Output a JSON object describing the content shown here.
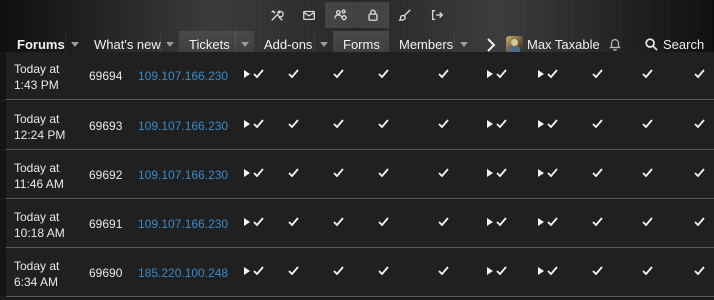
{
  "toolbar_icons": [
    "tools-icon",
    "mail-icon",
    "users-gear-icon",
    "lock-icon",
    "brush-icon",
    "logout-icon"
  ],
  "nav": {
    "tabs": [
      {
        "label": "Forums",
        "has_dropdown": true,
        "bold": true
      },
      {
        "label": "What's new",
        "has_dropdown": true
      },
      {
        "label": "Tickets",
        "has_dropdown": true,
        "highlight": true
      },
      {
        "label": "Add-ons",
        "has_dropdown": true
      },
      {
        "label": "Forms",
        "has_dropdown": false,
        "highlight": true
      },
      {
        "label": "Members",
        "has_dropdown": true
      }
    ],
    "user_name": "Max Taxable",
    "search_label": "Search"
  },
  "rows": [
    {
      "date": "Today at",
      "time": "1:43 PM",
      "id": "69694",
      "ip": "109.107.166.230",
      "marks": [
        "play-check",
        "check",
        "check",
        "check",
        "check",
        "play-check",
        "play-check",
        "check",
        "check",
        "check"
      ]
    },
    {
      "date": "Today at",
      "time": "12:24 PM",
      "id": "69693",
      "ip": "109.107.166.230",
      "marks": [
        "play-check",
        "check",
        "check",
        "check",
        "check",
        "play-check",
        "play-check",
        "check",
        "check",
        "check"
      ]
    },
    {
      "date": "Today at",
      "time": "11:46 AM",
      "id": "69692",
      "ip": "109.107.166.230",
      "marks": [
        "play-check",
        "check",
        "check",
        "check",
        "check",
        "play-check",
        "play-check",
        "check",
        "check",
        "check"
      ]
    },
    {
      "date": "Today at",
      "time": "10:18 AM",
      "id": "69691",
      "ip": "109.107.166.230",
      "marks": [
        "play-check",
        "check",
        "check",
        "check",
        "check",
        "play-check",
        "play-check",
        "check",
        "check",
        "check"
      ]
    },
    {
      "date": "Today at",
      "time": "6:34 AM",
      "id": "69690",
      "ip": "185.220.100.248",
      "marks": [
        "play-check",
        "check",
        "check",
        "check",
        "check",
        "play-check",
        "play-check",
        "check",
        "check",
        "check"
      ]
    }
  ],
  "colors": {
    "link": "#3a8ac8",
    "background": "#1b1b1b"
  }
}
